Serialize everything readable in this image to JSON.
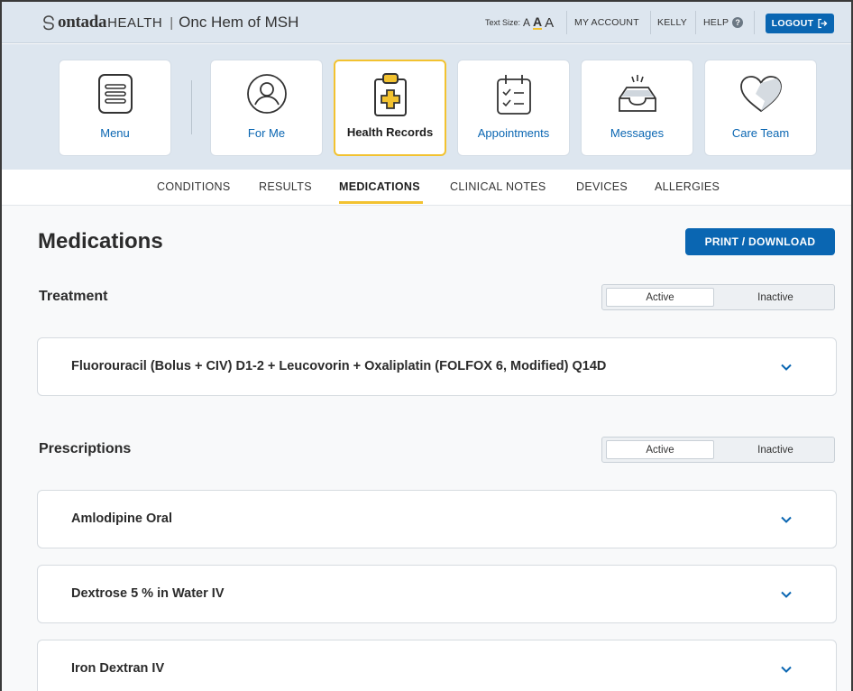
{
  "header": {
    "brand_ontada": "ontada",
    "brand_health": "HEALTH",
    "brand_sep": "|",
    "org_name": "Onc Hem of MSH",
    "text_size_label": "Text Size:",
    "text_size_a": "A",
    "my_account": "MY ACCOUNT",
    "user": "KELLY",
    "help": "HELP",
    "help_glyph": "?",
    "logout": "LOGOUT"
  },
  "tiles": [
    {
      "label": "Menu",
      "icon": "menu-icon"
    },
    {
      "label": "For Me",
      "icon": "user-icon"
    },
    {
      "label": "Health Records",
      "icon": "clipboard-icon",
      "active": true
    },
    {
      "label": "Appointments",
      "icon": "calendar-icon"
    },
    {
      "label": "Messages",
      "icon": "inbox-icon"
    },
    {
      "label": "Care Team",
      "icon": "heart-icon"
    }
  ],
  "subnav": [
    "CONDITIONS",
    "RESULTS",
    "MEDICATIONS",
    "CLINICAL NOTES",
    "DEVICES",
    "ALLERGIES"
  ],
  "subnav_active": "MEDICATIONS",
  "main": {
    "title": "Medications",
    "print_button": "PRINT / DOWNLOAD",
    "treatment": {
      "title": "Treatment",
      "toggle_active": "Active",
      "toggle_inactive": "Inactive",
      "items": [
        "Fluorouracil (Bolus + CIV) D1-2 + Leucovorin + Oxaliplatin (FOLFOX 6, Modified) Q14D"
      ]
    },
    "prescriptions": {
      "title": "Prescriptions",
      "toggle_active": "Active",
      "toggle_inactive": "Inactive",
      "items": [
        "Amlodipine Oral",
        "Dextrose 5 % in Water IV",
        "Iron Dextran IV"
      ]
    }
  },
  "colors": {
    "accent_blue": "#0a66b2",
    "accent_yellow": "#f2c230",
    "header_bg": "#dde6ef"
  }
}
